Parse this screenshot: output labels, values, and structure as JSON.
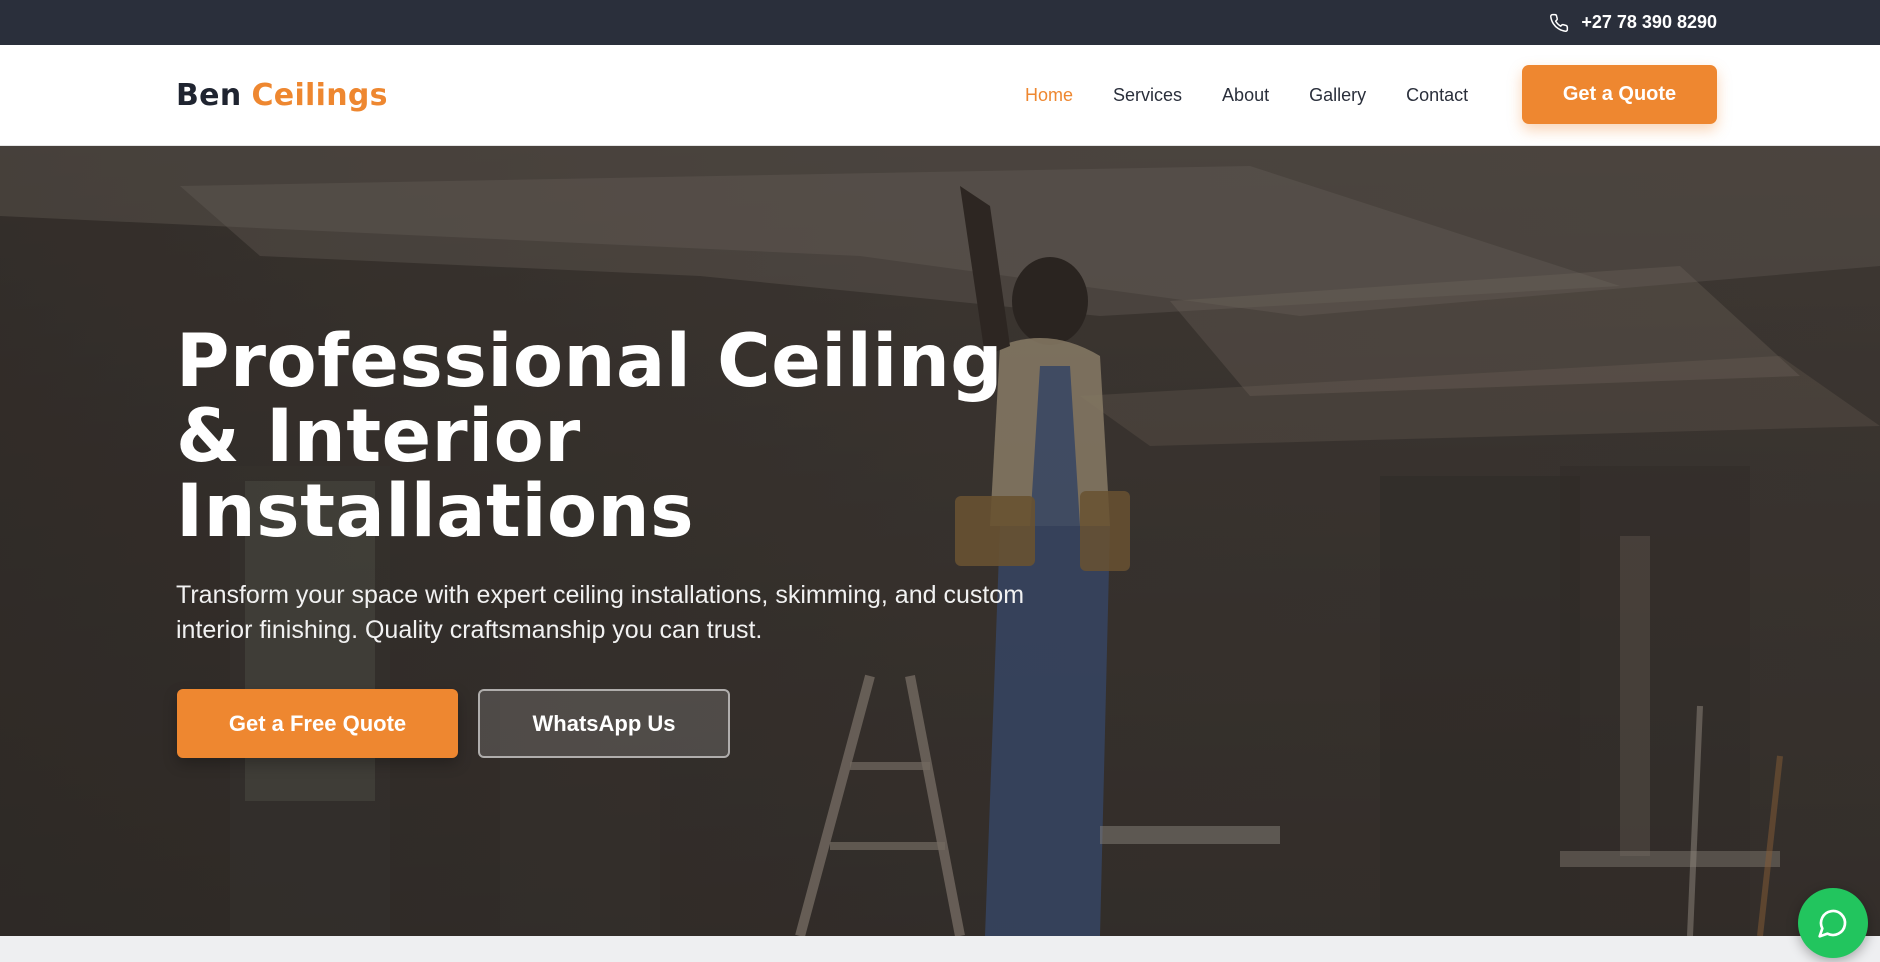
{
  "topbar": {
    "phone": "+27 78 390 8290",
    "phone_icon": "phone-icon"
  },
  "brand": {
    "part1": "Ben",
    "part2": "Ceilings",
    "accent": "#ee8730",
    "dark": "#2a2f3b"
  },
  "nav": {
    "items": [
      {
        "label": "Home",
        "active": true
      },
      {
        "label": "Services"
      },
      {
        "label": "About"
      },
      {
        "label": "Gallery"
      },
      {
        "label": "Contact"
      }
    ],
    "cta": "Get a Quote"
  },
  "hero": {
    "title_line1": "Professional Ceiling",
    "title_line2": "& Interior",
    "title_line3": "Installations",
    "subtitle": "Transform your space with expert ceiling installations, skimming, and custom interior finishing. Quality craftsmanship you can trust.",
    "primary_button": "Get a Free Quote",
    "secondary_button": "WhatsApp Us"
  },
  "chat": {
    "icon": "chat-bubble-icon",
    "color": "#22c55e"
  }
}
